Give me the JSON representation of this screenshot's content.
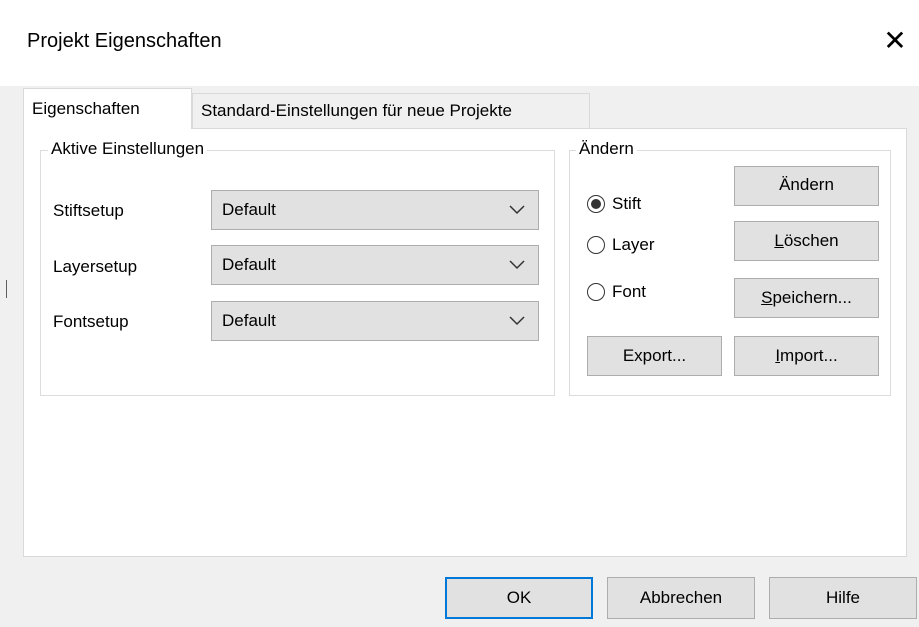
{
  "window": {
    "title": "Projekt Eigenschaften",
    "close_glyph": "✕"
  },
  "tabs": [
    {
      "label": "Eigenschaften",
      "active": true
    },
    {
      "label": "Standard-Einstellungen für neue Projekte",
      "active": false
    }
  ],
  "active_settings": {
    "legend": "Aktive Einstellungen",
    "rows": [
      {
        "label": "Stiftsetup",
        "value": "Default"
      },
      {
        "label": "Layersetup",
        "value": "Default"
      },
      {
        "label": "Fontsetup",
        "value": "Default"
      }
    ]
  },
  "change_group": {
    "legend": "Ändern",
    "radios": [
      {
        "label": "Stift",
        "checked": true
      },
      {
        "label": "Layer",
        "checked": false
      },
      {
        "label": "Font",
        "checked": false
      }
    ],
    "buttons": {
      "change": {
        "label": "Ändern"
      },
      "delete": {
        "pre": "",
        "mnemonic": "L",
        "post": "öschen"
      },
      "save": {
        "pre": "",
        "mnemonic": "S",
        "post": "peichern..."
      },
      "export": {
        "label": "Export..."
      },
      "import": {
        "pre": "",
        "mnemonic": "I",
        "post": "mport..."
      }
    }
  },
  "footer": {
    "ok": "OK",
    "cancel": "Abbrechen",
    "help": "Hilfe"
  },
  "icons": {
    "close": "close-icon",
    "dropdown": "chevron-down-icon"
  },
  "colors": {
    "dialog_bg": "#f0f0f0",
    "panel_bg": "#ffffff",
    "button_bg": "#e1e1e1",
    "focus_border": "#0078d7"
  }
}
